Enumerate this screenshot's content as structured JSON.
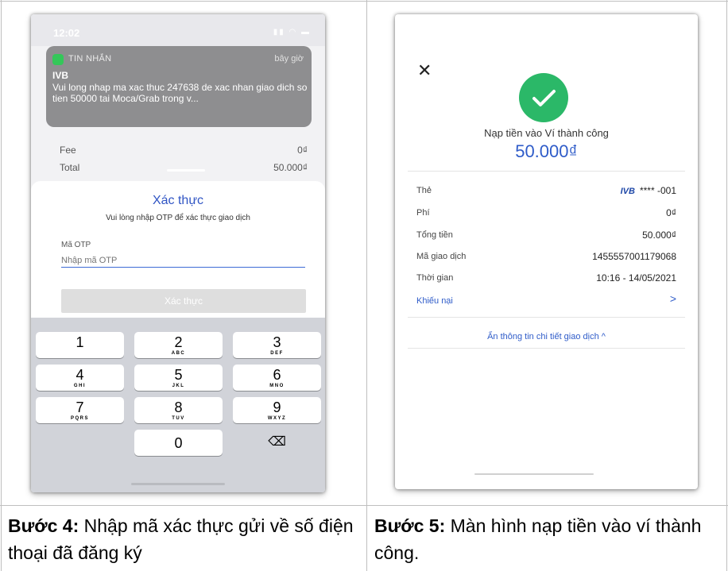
{
  "left_phone": {
    "status_time": "12:02",
    "notification": {
      "app_name": "TIN NHẮN",
      "time": "bây giờ",
      "sender": "IVB",
      "message": "Vui long nhap ma xac thuc 247638 de xac nhan giao dich so tien 50000 tai Moca/Grab trong v..."
    },
    "summary": [
      {
        "label": "Fee",
        "value": "0₫"
      },
      {
        "label": "Total",
        "value": "50.000₫"
      }
    ],
    "sheet": {
      "title": "Xác thực",
      "subtitle": "Vui lòng nhập OTP để xác thực giao dịch",
      "field_label": "Mã OTP",
      "field_placeholder": "Nhập mã OTP",
      "button_label": "Xác thực"
    },
    "keypad": [
      {
        "n": "1",
        "l": ""
      },
      {
        "n": "2",
        "l": "ABC"
      },
      {
        "n": "3",
        "l": "DEF"
      },
      {
        "n": "4",
        "l": "GHI"
      },
      {
        "n": "5",
        "l": "JKL"
      },
      {
        "n": "6",
        "l": "MNO"
      },
      {
        "n": "7",
        "l": "PQRS"
      },
      {
        "n": "8",
        "l": "TUV"
      },
      {
        "n": "9",
        "l": "WXYZ"
      },
      {
        "n": "0",
        "l": ""
      }
    ]
  },
  "right_phone": {
    "title": "Nạp tiền vào Ví thành công",
    "amount": "50.000₫",
    "rows": [
      {
        "label": "Thẻ",
        "value": "**** -001",
        "bank": "IVB"
      },
      {
        "label": "Phí",
        "value": "0₫"
      },
      {
        "label": "Tổng tiền",
        "value": "50.000₫"
      },
      {
        "label": "Mã giao dịch",
        "value": "1455557001179068"
      },
      {
        "label": "Thời gian",
        "value": "10:16 - 14/05/2021"
      }
    ],
    "complaint_link": "Khiếu nại",
    "toggle_label": "Ẩn thông tin chi tiết giao dịch ^"
  },
  "captions": {
    "step4_label": "Bước 4:",
    "step4_text": " Nhập mã xác thực gửi về số điện thoại đã đăng ký",
    "step5_label": "Bước 5:",
    "step5_text": " Màn hình nạp tiền vào ví thành công."
  },
  "colors": {
    "accent_blue": "#2f5cc9",
    "success_green": "#2bb868",
    "border_gray": "#bfbfbf"
  }
}
